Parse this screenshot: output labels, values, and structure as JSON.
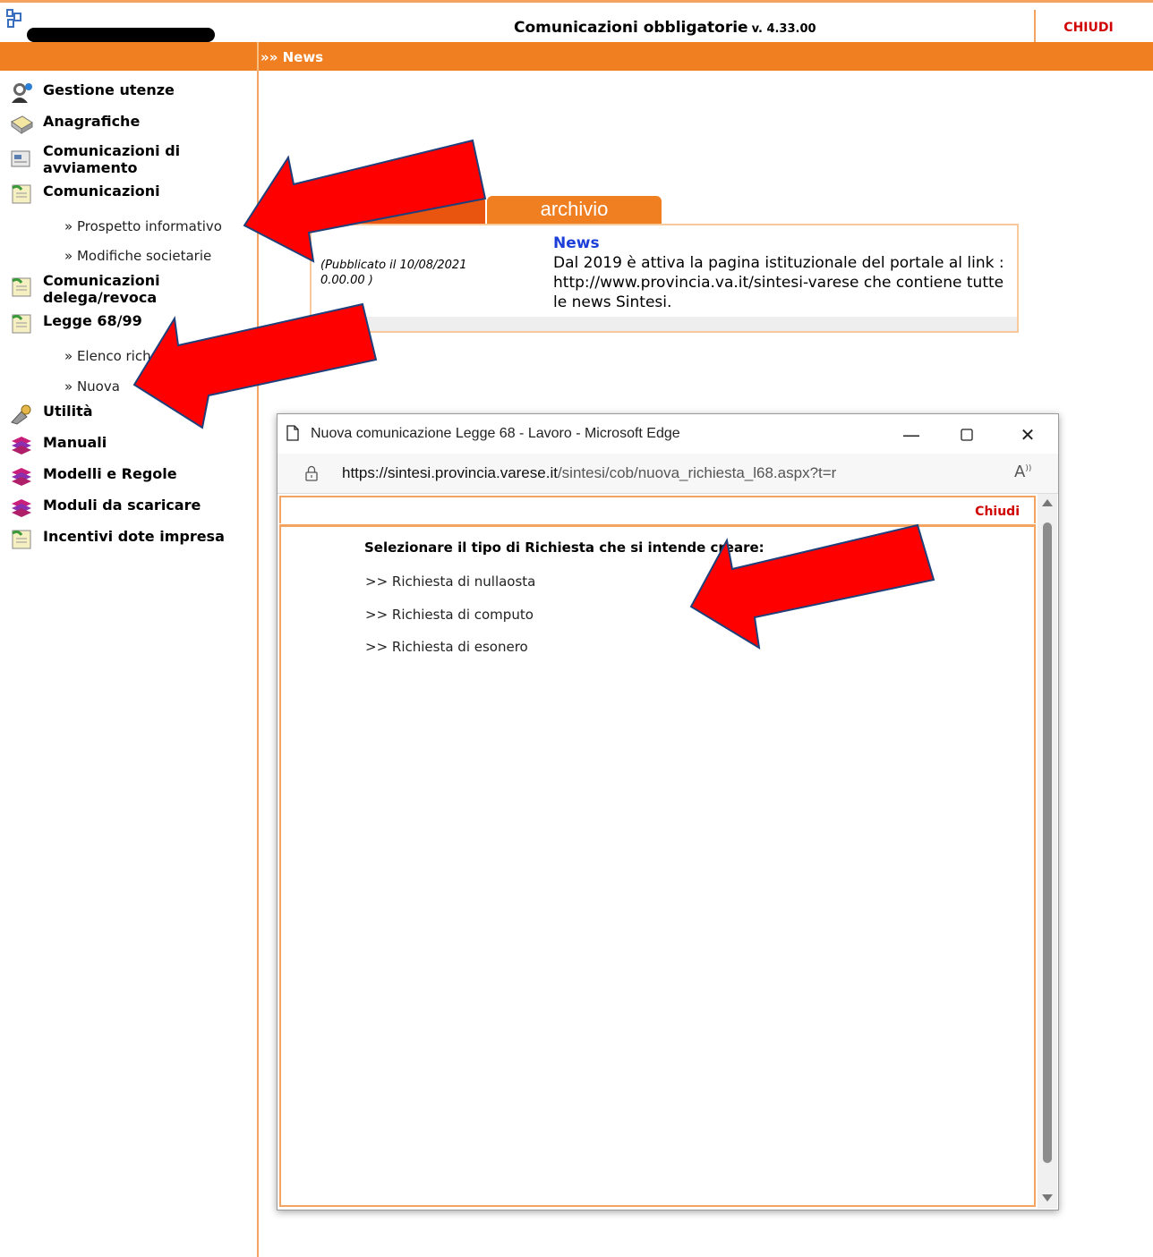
{
  "header": {
    "app_title": "Comunicazioni obbligatorie",
    "version": "v. 4.33.00",
    "close_label": "CHIUDI"
  },
  "breadcrumb": "»» News",
  "sidebar": {
    "items": [
      {
        "label": "Gestione utenze",
        "icon": "users-icon"
      },
      {
        "label": "Anagrafiche",
        "icon": "book-icon"
      },
      {
        "label": "Comunicazioni di avviamento",
        "icon": "document-icon"
      },
      {
        "label": "Comunicazioni",
        "icon": "notes-icon"
      },
      {
        "label": "Comunicazioni delega/revoca",
        "icon": "notes-icon"
      },
      {
        "label": "Legge 68/99",
        "icon": "notes-icon"
      },
      {
        "label": "Utilità",
        "icon": "tools-icon"
      },
      {
        "label": "Manuali",
        "icon": "books-icon"
      },
      {
        "label": "Modelli e Regole",
        "icon": "books-icon"
      },
      {
        "label": "Moduli da scaricare",
        "icon": "books-icon"
      },
      {
        "label": "Incentivi dote impresa",
        "icon": "notes-icon"
      }
    ],
    "subitems": {
      "prospetto": "» Prospetto informativo",
      "modifiche": "» Modifiche societarie",
      "elenco": "» Elenco rich",
      "nuova": "» Nuova"
    }
  },
  "news": {
    "tab_archive": "archivio",
    "date": "(Pubblicato il 10/08/2021 0.00.00 )",
    "title": "News",
    "body": "Dal 2019 è attiva la pagina istituzionale del portale al link : http://www.provincia.va.it/sintesi-varese che contiene tutte le news Sintesi."
  },
  "popup": {
    "window_title": "Nuova comunicazione Legge 68 - Lavoro - Microsoft Edge",
    "url_domain": "https://sintesi.provincia.varese.it",
    "url_path": "/sintesi/cob/nuova_richiesta_l68.aspx?t=r",
    "close_label": "Chiudi",
    "prompt": "Selezionare il tipo di Richiesta che si intende creare:",
    "options": [
      ">> Richiesta di nullaosta",
      ">> Richiesta di computo",
      ">> Richiesta di esonero"
    ]
  },
  "colors": {
    "orange": "#f07f22",
    "red_close": "#d00000",
    "news_blue": "#1c3ed9",
    "arrow_red": "#ff0000"
  }
}
